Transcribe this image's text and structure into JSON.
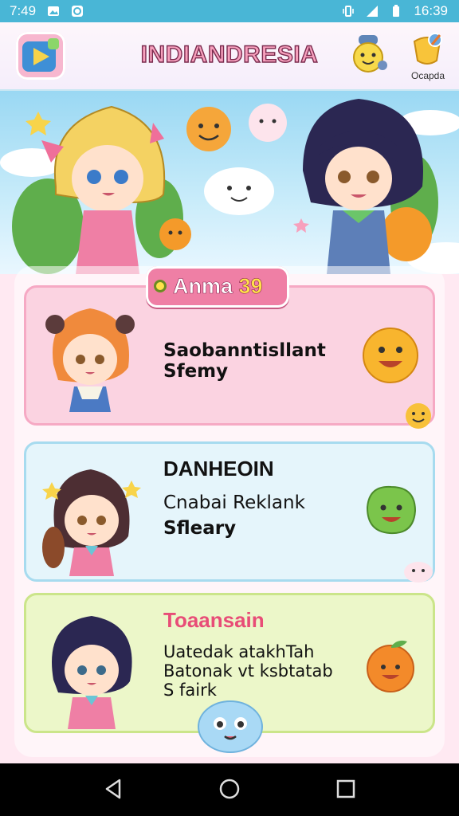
{
  "status_bar": {
    "time_left": "7:49",
    "time_right": "16:39"
  },
  "header": {
    "title": "INDIANDRESIA",
    "profile_label": "Ocapda"
  },
  "section": {
    "title": "Anma",
    "count": "39"
  },
  "cards": [
    {
      "title": "",
      "line1": "Saobanntisllant",
      "line2": "Sfemy",
      "accent": "#f6a9c4"
    },
    {
      "title": "DANHEOIN",
      "line1": "Cnabai Reklank",
      "line2": "Sfleary",
      "accent": "#a7dbef"
    },
    {
      "title": "Toaansain",
      "line1": "Uatedak atakhTah",
      "line2": "Batonak vt ksbtatab",
      "line3": "S fairk",
      "accent": "#cbe58a"
    }
  ],
  "colors": {
    "status_bar": "#49b6d6",
    "pill": "#ef7fa5",
    "card_pink": "#fbd3e1",
    "card_blue": "#e5f5fb",
    "card_green": "#ecf7c9"
  },
  "icons": [
    "app-logo-icon",
    "mascot-icon",
    "profile-badge-icon",
    "back-icon",
    "home-icon",
    "recents-icon"
  ]
}
